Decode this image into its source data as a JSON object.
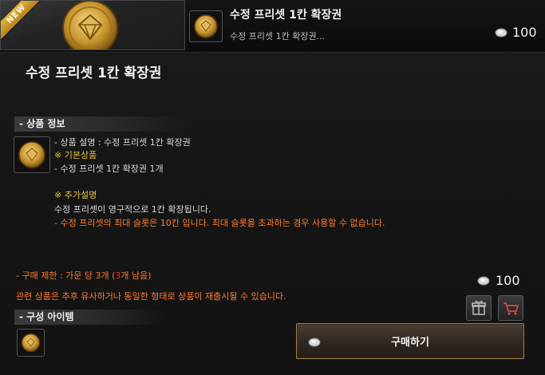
{
  "header": {
    "new_badge": "NEW",
    "title": "수정 프리셋 1칸 확장권",
    "subtitle": "수정 프리셋 1칸 확장권...",
    "price": "100"
  },
  "product": {
    "title": "수정 프리셋 1칸 확장권",
    "info_section_label": "- 상품 정보",
    "description_line": "- 상품 설명 : 수정 프리셋 1칸 확장권",
    "basic_header": "※ 기본상품",
    "basic_item": "- 수정 프리셋 1칸 확장권 1개",
    "extra_header": "※ 추가설명",
    "extra_line": "수정 프리셋이 영구적으로 1칸 확장됩니다.",
    "warning_line": "- 수정 프리셋의 최대 슬롯은 10칸 입니다. 최대 슬롯을 초과하는 경우 사용할 수 없습니다.",
    "limit_prefix": "- 구매 제한 : 가문 당 3개 (",
    "limit_remaining": "3",
    "limit_suffix": "개 남음)",
    "notice": "관련 상품은 추후 유사하거나 동일한 형태로 상품이 재출시될 수 있습니다.",
    "components_label": "- 구성 아이템",
    "price": "100",
    "buy_label": "구매하기"
  },
  "colors": {
    "accent_orange": "#ff7a2e",
    "accent_gold": "#e8c23a",
    "limit_red": "#ff2b2b",
    "buy_border": "#a07a4a"
  },
  "icons": {
    "product": "gold-coin-icon",
    "currency": "silver-coin-icon",
    "gift": "gift-icon",
    "cart": "cart-icon"
  }
}
